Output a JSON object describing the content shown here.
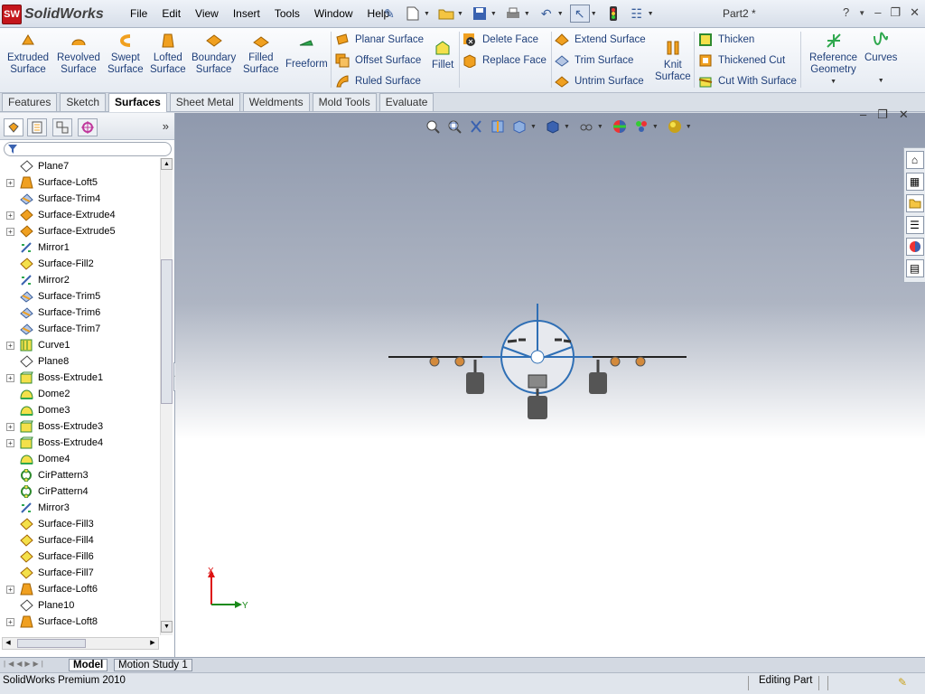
{
  "app": {
    "logo_text": "SolidWorks",
    "logo_badge": "SW",
    "doc_title": "Part2 *"
  },
  "menus": [
    "File",
    "Edit",
    "View",
    "Insert",
    "Tools",
    "Window",
    "Help"
  ],
  "toolbar_big": [
    {
      "label": "Extruded\nSurface",
      "icon": "extruded-surface-icon"
    },
    {
      "label": "Revolved\nSurface",
      "icon": "revolved-surface-icon"
    },
    {
      "label": "Swept\nSurface",
      "icon": "swept-surface-icon"
    },
    {
      "label": "Lofted\nSurface",
      "icon": "lofted-surface-icon"
    },
    {
      "label": "Boundary\nSurface",
      "icon": "boundary-surface-icon"
    },
    {
      "label": "Filled\nSurface",
      "icon": "filled-surface-icon"
    },
    {
      "label": "Freeform",
      "icon": "freeform-icon"
    }
  ],
  "toolbar_small": {
    "planar": "Planar Surface",
    "offset": "Offset Surface",
    "ruled": "Ruled Surface",
    "fillet": "Fillet",
    "delete_face": "Delete Face",
    "replace_face": "Replace Face",
    "extend": "Extend Surface",
    "trim": "Trim Surface",
    "untrim": "Untrim Surface",
    "knit": "Knit\nSurface",
    "thicken": "Thicken",
    "thickened_cut": "Thickened Cut",
    "cut_with_surface": "Cut With Surface",
    "ref_geometry": "Reference\nGeometry",
    "curves": "Curves"
  },
  "cmd_tabs": [
    "Features",
    "Sketch",
    "Surfaces",
    "Sheet Metal",
    "Weldments",
    "Mold Tools",
    "Evaluate"
  ],
  "active_tab": "Surfaces",
  "tree": [
    {
      "label": "Plane7",
      "type": "plane",
      "exp": false
    },
    {
      "label": "Surface-Loft5",
      "type": "loft",
      "exp": true
    },
    {
      "label": "Surface-Trim4",
      "type": "trim",
      "exp": false
    },
    {
      "label": "Surface-Extrude4",
      "type": "extrude",
      "exp": true
    },
    {
      "label": "Surface-Extrude5",
      "type": "extrude",
      "exp": true
    },
    {
      "label": "Mirror1",
      "type": "mirror",
      "exp": false
    },
    {
      "label": "Surface-Fill2",
      "type": "fill",
      "exp": false
    },
    {
      "label": "Mirror2",
      "type": "mirror",
      "exp": false
    },
    {
      "label": "Surface-Trim5",
      "type": "trim",
      "exp": false
    },
    {
      "label": "Surface-Trim6",
      "type": "trim",
      "exp": false
    },
    {
      "label": "Surface-Trim7",
      "type": "trim",
      "exp": false
    },
    {
      "label": "Curve1",
      "type": "curve",
      "exp": true
    },
    {
      "label": "Plane8",
      "type": "plane",
      "exp": false
    },
    {
      "label": "Boss-Extrude1",
      "type": "boss",
      "exp": true
    },
    {
      "label": "Dome2",
      "type": "dome",
      "exp": false
    },
    {
      "label": "Dome3",
      "type": "dome",
      "exp": false
    },
    {
      "label": "Boss-Extrude3",
      "type": "boss",
      "exp": true
    },
    {
      "label": "Boss-Extrude4",
      "type": "boss",
      "exp": true
    },
    {
      "label": "Dome4",
      "type": "dome",
      "exp": false
    },
    {
      "label": "CirPattern3",
      "type": "pattern",
      "exp": false
    },
    {
      "label": "CirPattern4",
      "type": "pattern",
      "exp": false
    },
    {
      "label": "Mirror3",
      "type": "mirror",
      "exp": false
    },
    {
      "label": "Surface-Fill3",
      "type": "fill",
      "exp": false
    },
    {
      "label": "Surface-Fill4",
      "type": "fill",
      "exp": false
    },
    {
      "label": "Surface-Fill6",
      "type": "fill",
      "exp": false
    },
    {
      "label": "Surface-Fill7",
      "type": "fill",
      "exp": false
    },
    {
      "label": "Surface-Loft6",
      "type": "loft",
      "exp": true
    },
    {
      "label": "Plane10",
      "type": "plane",
      "exp": false
    },
    {
      "label": "Surface-Loft8",
      "type": "loft",
      "exp": true
    }
  ],
  "bottom_tabs": [
    "Model",
    "Motion Study 1"
  ],
  "triad": {
    "x_label": "X",
    "y_label": "Y"
  },
  "status": {
    "left": "SolidWorks Premium 2010",
    "mode": "Editing Part"
  },
  "colors": {
    "accent": "#1f3f7a",
    "brand_red": "#c4161c",
    "surface_orange": "#f0a020"
  }
}
